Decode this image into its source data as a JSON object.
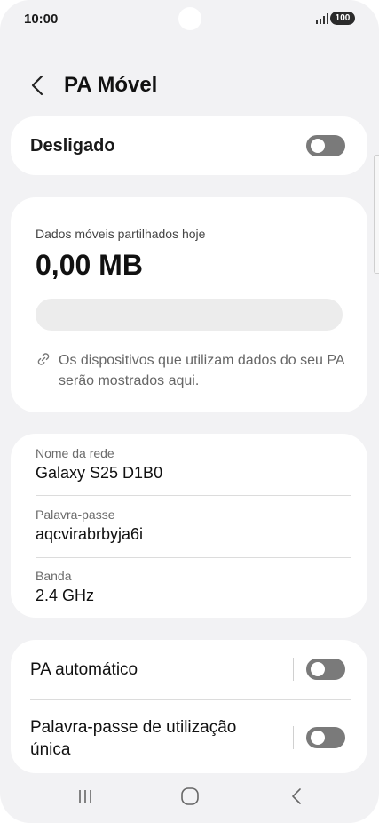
{
  "status_bar": {
    "time": "10:00",
    "battery": "100",
    "signal_icon": "signal-bars-icon"
  },
  "header": {
    "back_icon": "chevron-left-icon",
    "title": "PA Móvel"
  },
  "hotspot_toggle": {
    "label": "Desligado",
    "enabled": false
  },
  "usage": {
    "label": "Dados móveis partilhados hoje",
    "value": "0,00 MB",
    "progress_fraction": 0,
    "info_icon": "link-icon",
    "info_text": "Os dispositivos que utilizam dados do seu PA serão mostrados aqui."
  },
  "network": {
    "name_label": "Nome da rede",
    "name_value": "Galaxy S25 D1B0",
    "password_label": "Palavra-passe",
    "password_value": "aqcvirabrbyja6i",
    "band_label": "Banda",
    "band_value": "2.4 GHz"
  },
  "settings": {
    "auto_hotspot_label": "PA automático",
    "auto_hotspot_enabled": false,
    "one_time_password_label": "Palavra-passe de utilização única",
    "one_time_password_enabled": false
  },
  "nav": {
    "recents_icon": "recent-apps-icon",
    "home_icon": "home-icon",
    "back_icon": "back-icon"
  },
  "colors": {
    "background": "#f2f2f4",
    "card": "#ffffff",
    "toggle_off": "#6a6a6a"
  }
}
